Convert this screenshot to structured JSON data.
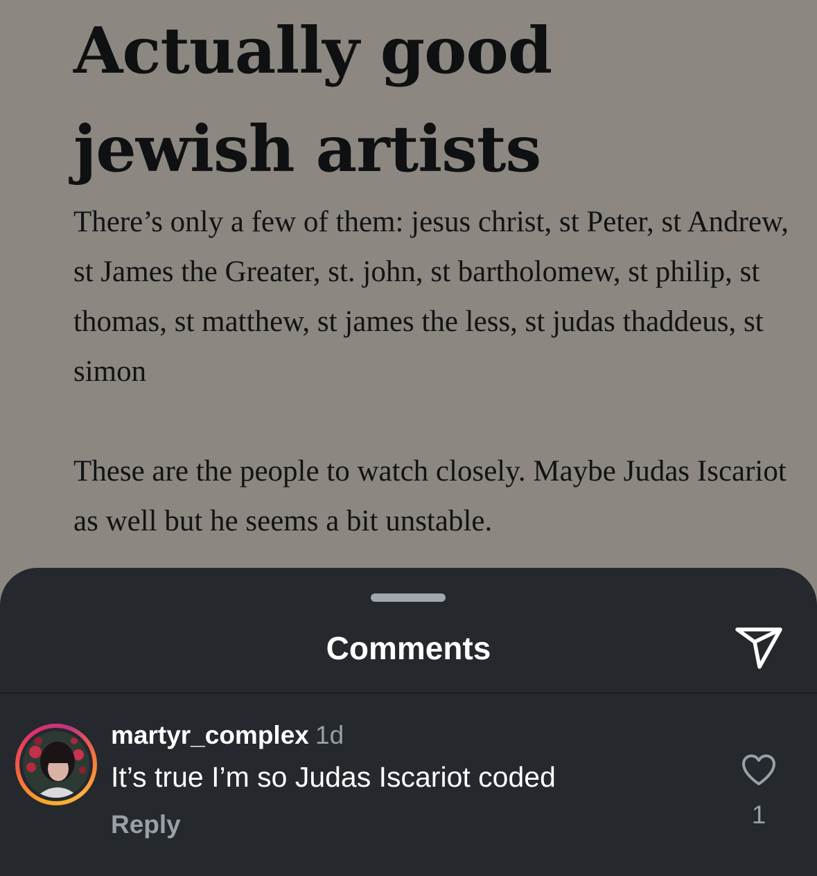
{
  "post": {
    "title": "Actually good jewish artists",
    "paragraphs": [
      "There’s only a few of them: jesus christ, st Peter, st Andrew, st James the Greater, st. john, st bartholomew, st philip, st thomas, st matthew, st james the less, st judas thaddeus, st simon",
      "These are the people to watch closely. Maybe Judas Iscariot as well but he seems a bit unstable."
    ]
  },
  "comments_sheet": {
    "title": "Comments",
    "share_icon": "paper-plane-icon",
    "comments": [
      {
        "username": "martyr_complex",
        "time": "1d",
        "text": "It’s true I’m so Judas Iscariot coded",
        "reply_label": "Reply",
        "like_icon": "heart-icon",
        "like_count": "1"
      }
    ]
  },
  "colors": {
    "post_background": "#8c8780",
    "post_text": "#121314",
    "sheet_background": "#25282d",
    "secondary_text": "#9aa0a8",
    "primary_text": "#ffffff"
  }
}
